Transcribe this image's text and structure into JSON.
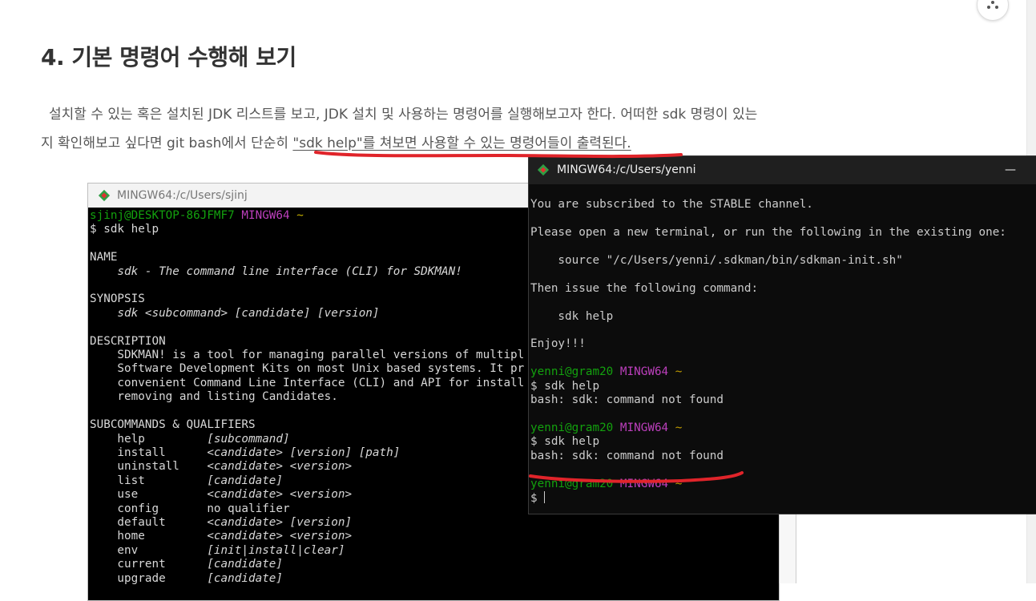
{
  "article": {
    "heading": "4. 기본 명령어 수행해 보기",
    "para_line1": "설치할 수 있는 혹은 설치된 JDK 리스트를 보고, JDK 설치 및 사용하는 명령어를 실행해보고자 한다. 어떠한 sdk 명령이 있는",
    "para_line2_a": "지 확인해보고 싶다면 git bash에서 단순히 ",
    "para_line2_b": "\"sdk help\"를 쳐보면 사용할 수 있는 명령어들이 출력된다.",
    "accent_color": "#e0242a"
  },
  "left_terminal": {
    "title": "MINGW64:/c/Users/sjinj",
    "prompt_user": "sjinj@DESKTOP-86JFMF7",
    "prompt_env": "MINGW64",
    "prompt_path": "~",
    "command": "$ sdk help",
    "name_header": "NAME",
    "name_text": "    sdk - The command line interface (CLI) for SDKMAN!",
    "synopsis_header": "SYNOPSIS",
    "synopsis_text": "    sdk <subcommand> [candidate] [version]",
    "description_header": "DESCRIPTION",
    "description_lines": [
      "    SDKMAN! is a tool for managing parallel versions of multipl",
      "    Software Development Kits on most Unix based systems. It pr",
      "    convenient Command Line Interface (CLI) and API for install",
      "    removing and listing Candidates."
    ],
    "subcommands_header": "SUBCOMMANDS & QUALIFIERS",
    "subcommands": [
      {
        "cmd": "    help         ",
        "args": "[subcommand]"
      },
      {
        "cmd": "    install      ",
        "args": "<candidate> [version] [path]"
      },
      {
        "cmd": "    uninstall    ",
        "args": "<candidate> <version>"
      },
      {
        "cmd": "    list         ",
        "args": "[candidate]"
      },
      {
        "cmd": "    use          ",
        "args": "<candidate> <version>"
      },
      {
        "cmd": "    config       ",
        "args": "no qualifier"
      },
      {
        "cmd": "    default      ",
        "args": "<candidate> [version]"
      },
      {
        "cmd": "    home         ",
        "args": "<candidate> <version>"
      },
      {
        "cmd": "    env          ",
        "args": "[init|install|clear]"
      },
      {
        "cmd": "    current      ",
        "args": "[candidate]"
      },
      {
        "cmd": "    upgrade      ",
        "args": "[candidate]"
      }
    ]
  },
  "right_terminal": {
    "title": "MINGW64:/c/Users/yenni",
    "minimize": "—",
    "line_subscribed": "You are subscribed to the STABLE channel.",
    "line_open": "Please open a new terminal, or run the following in the existing one:",
    "line_source": "    source \"/c/Users/yenni/.sdkman/bin/sdkman-init.sh\"",
    "line_then": "Then issue the following command:",
    "line_cmd": "    sdk help",
    "line_enjoy": "Enjoy!!!",
    "prompt_user": "yenni@gram20",
    "prompt_env": "MINGW64",
    "prompt_path": "~",
    "command": "$ sdk help",
    "error": "bash: sdk: command not found",
    "final_prompt": "$ "
  }
}
